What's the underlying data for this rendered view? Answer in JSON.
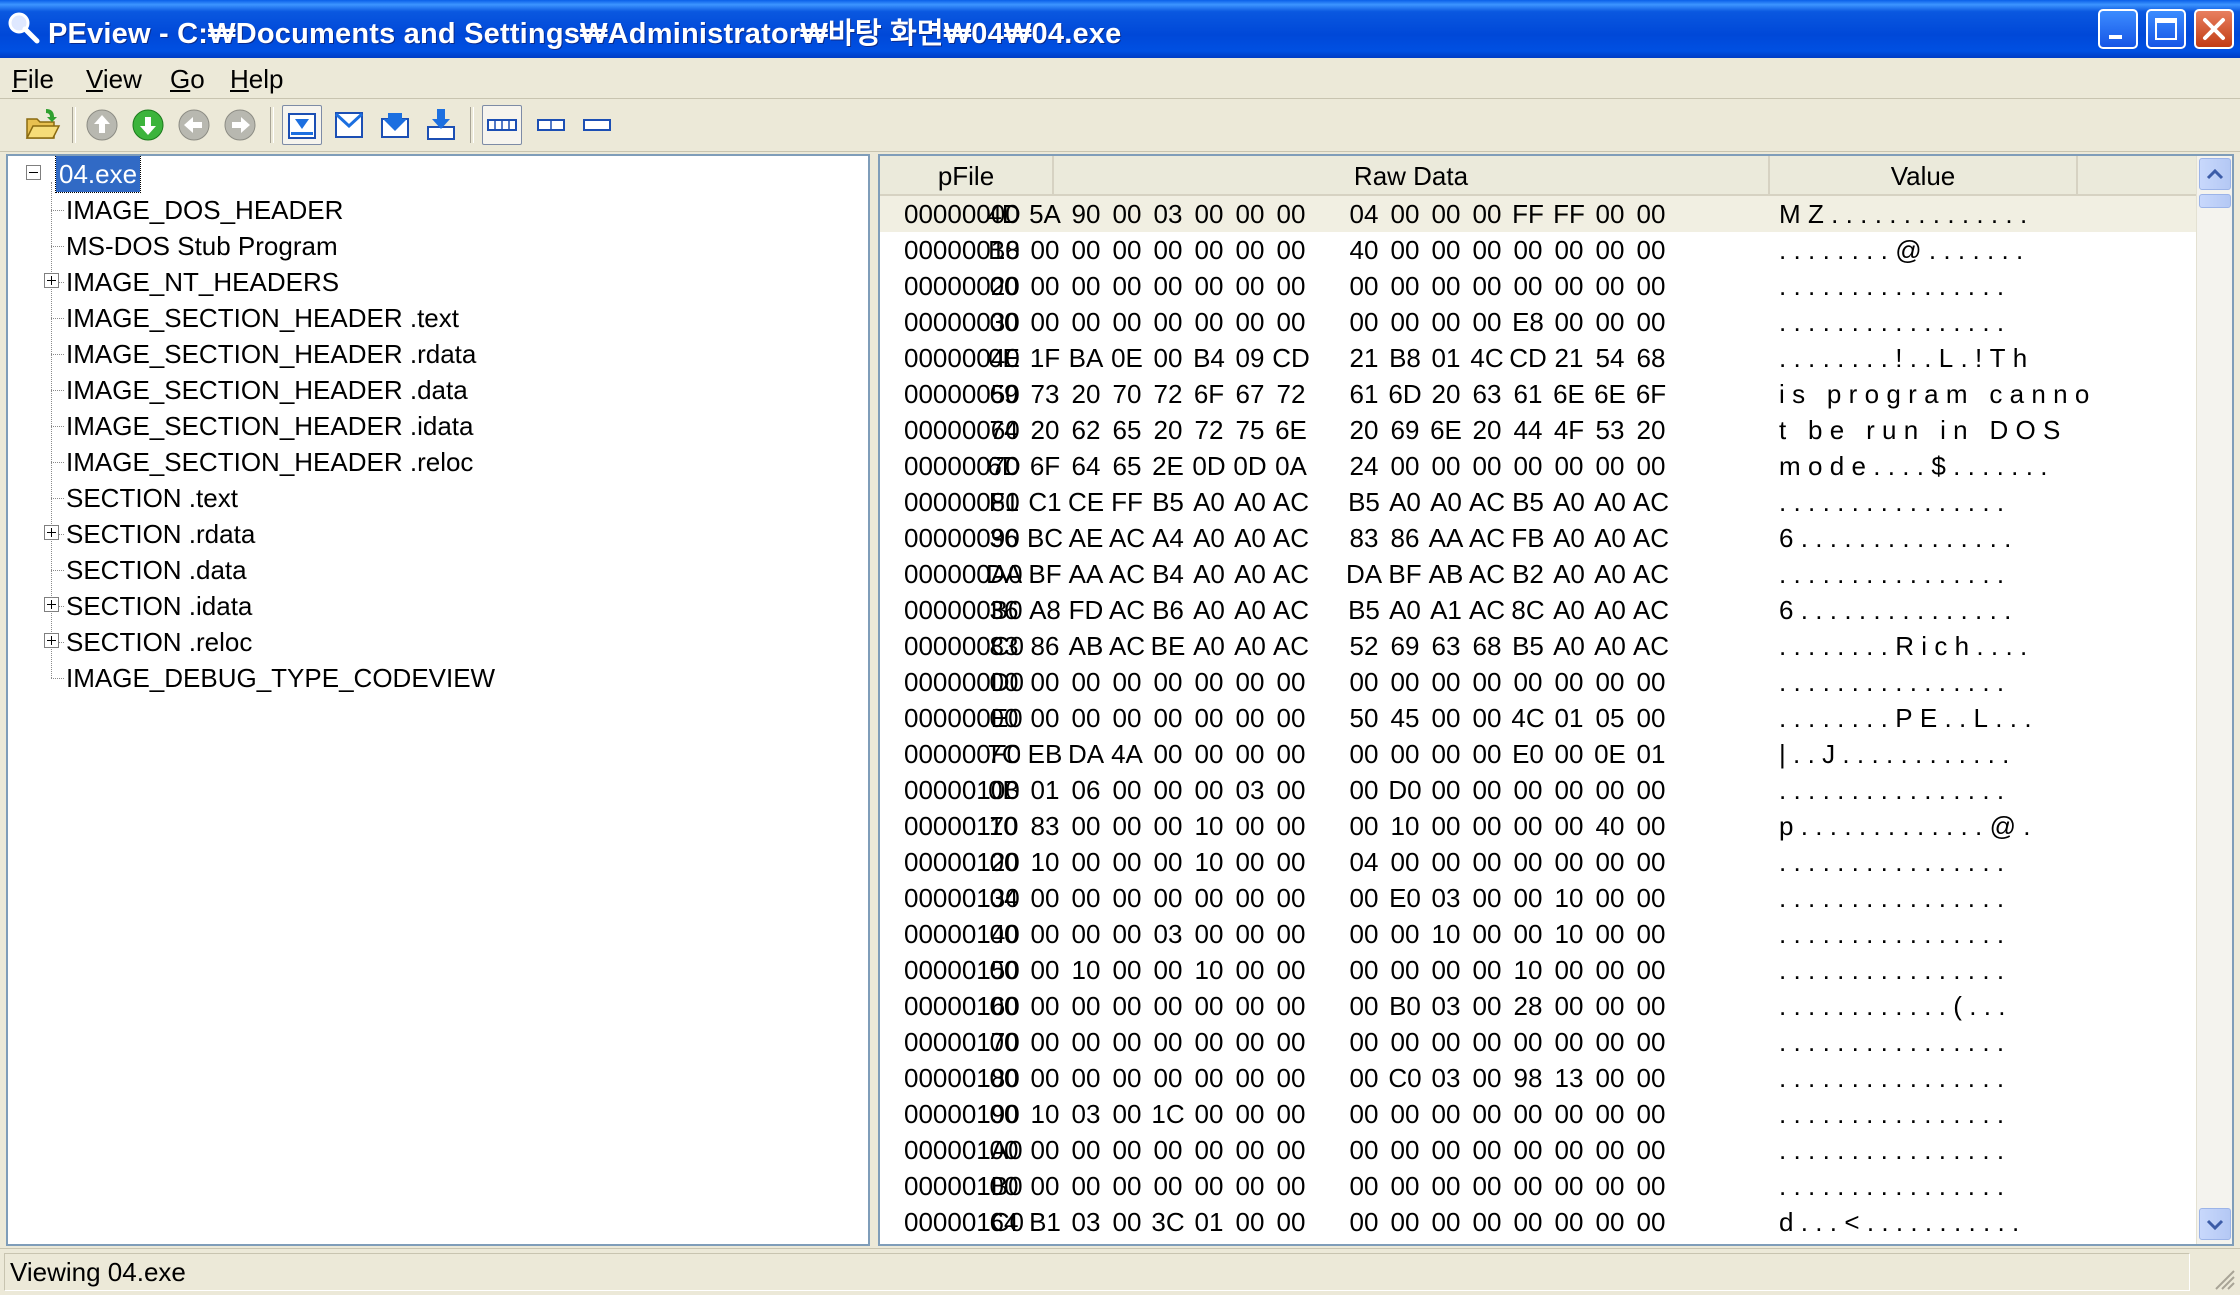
{
  "window": {
    "title": "PEview - C:₩Documents and Settings₩Administrator₩바탕 화면₩04₩04.exe",
    "minimize_icon": "minimize-icon",
    "maximize_icon": "maximize-icon",
    "close_icon": "close-icon"
  },
  "menu": [
    "File",
    "View",
    "Go",
    "Help"
  ],
  "toolbar": {
    "buttons": [
      "open-file-icon",
      "go-up-icon",
      "go-down-icon",
      "go-back-icon",
      "go-forward-icon",
      "view-byte-icon",
      "view-word-icon",
      "view-dword-icon",
      "view-qword-icon",
      "row-wide-icon",
      "row-medium-icon",
      "row-narrow-icon"
    ]
  },
  "tree": {
    "root": "04.exe",
    "items": [
      {
        "label": "IMAGE_DOS_HEADER",
        "expandable": false
      },
      {
        "label": "MS-DOS Stub Program",
        "expandable": false
      },
      {
        "label": "IMAGE_NT_HEADERS",
        "expandable": true
      },
      {
        "label": "IMAGE_SECTION_HEADER .text",
        "expandable": false
      },
      {
        "label": "IMAGE_SECTION_HEADER .rdata",
        "expandable": false
      },
      {
        "label": "IMAGE_SECTION_HEADER .data",
        "expandable": false
      },
      {
        "label": "IMAGE_SECTION_HEADER .idata",
        "expandable": false
      },
      {
        "label": "IMAGE_SECTION_HEADER .reloc",
        "expandable": false
      },
      {
        "label": "SECTION .text",
        "expandable": false
      },
      {
        "label": "SECTION .rdata",
        "expandable": true
      },
      {
        "label": "SECTION .data",
        "expandable": false
      },
      {
        "label": "SECTION .idata",
        "expandable": true
      },
      {
        "label": "SECTION .reloc",
        "expandable": true
      },
      {
        "label": "IMAGE_DEBUG_TYPE_CODEVIEW",
        "expandable": false
      }
    ]
  },
  "list": {
    "columns": {
      "pfile": "pFile",
      "raw": "Raw Data",
      "value": "Value"
    },
    "rows": [
      {
        "pfile": "00000000",
        "raw": [
          "4D",
          "5A",
          "90",
          "00",
          "03",
          "00",
          "00",
          "00",
          "04",
          "00",
          "00",
          "00",
          "FF",
          "FF",
          "00",
          "00"
        ],
        "value": "MZ.............."
      },
      {
        "pfile": "00000010",
        "raw": [
          "B8",
          "00",
          "00",
          "00",
          "00",
          "00",
          "00",
          "00",
          "40",
          "00",
          "00",
          "00",
          "00",
          "00",
          "00",
          "00"
        ],
        "value": "........@......."
      },
      {
        "pfile": "00000020",
        "raw": [
          "00",
          "00",
          "00",
          "00",
          "00",
          "00",
          "00",
          "00",
          "00",
          "00",
          "00",
          "00",
          "00",
          "00",
          "00",
          "00"
        ],
        "value": "................"
      },
      {
        "pfile": "00000030",
        "raw": [
          "00",
          "00",
          "00",
          "00",
          "00",
          "00",
          "00",
          "00",
          "00",
          "00",
          "00",
          "00",
          "E8",
          "00",
          "00",
          "00"
        ],
        "value": "................"
      },
      {
        "pfile": "00000040",
        "raw": [
          "0E",
          "1F",
          "BA",
          "0E",
          "00",
          "B4",
          "09",
          "CD",
          "21",
          "B8",
          "01",
          "4C",
          "CD",
          "21",
          "54",
          "68"
        ],
        "value": "........!..L.!Th"
      },
      {
        "pfile": "00000050",
        "raw": [
          "69",
          "73",
          "20",
          "70",
          "72",
          "6F",
          "67",
          "72",
          "61",
          "6D",
          "20",
          "63",
          "61",
          "6E",
          "6E",
          "6F"
        ],
        "value": "is program canno"
      },
      {
        "pfile": "00000060",
        "raw": [
          "74",
          "20",
          "62",
          "65",
          "20",
          "72",
          "75",
          "6E",
          "20",
          "69",
          "6E",
          "20",
          "44",
          "4F",
          "53",
          "20"
        ],
        "value": "t be run in DOS "
      },
      {
        "pfile": "00000070",
        "raw": [
          "6D",
          "6F",
          "64",
          "65",
          "2E",
          "0D",
          "0D",
          "0A",
          "24",
          "00",
          "00",
          "00",
          "00",
          "00",
          "00",
          "00"
        ],
        "value": "mode....$......."
      },
      {
        "pfile": "00000080",
        "raw": [
          "F1",
          "C1",
          "CE",
          "FF",
          "B5",
          "A0",
          "A0",
          "AC",
          "B5",
          "A0",
          "A0",
          "AC",
          "B5",
          "A0",
          "A0",
          "AC"
        ],
        "value": "................"
      },
      {
        "pfile": "00000090",
        "raw": [
          "36",
          "BC",
          "AE",
          "AC",
          "A4",
          "A0",
          "A0",
          "AC",
          "83",
          "86",
          "AA",
          "AC",
          "FB",
          "A0",
          "A0",
          "AC"
        ],
        "value": "6..............."
      },
      {
        "pfile": "000000A0",
        "raw": [
          "DA",
          "BF",
          "AA",
          "AC",
          "B4",
          "A0",
          "A0",
          "AC",
          "DA",
          "BF",
          "AB",
          "AC",
          "B2",
          "A0",
          "A0",
          "AC"
        ],
        "value": "................"
      },
      {
        "pfile": "000000B0",
        "raw": [
          "36",
          "A8",
          "FD",
          "AC",
          "B6",
          "A0",
          "A0",
          "AC",
          "B5",
          "A0",
          "A1",
          "AC",
          "8C",
          "A0",
          "A0",
          "AC"
        ],
        "value": "6..............."
      },
      {
        "pfile": "000000C0",
        "raw": [
          "83",
          "86",
          "AB",
          "AC",
          "BE",
          "A0",
          "A0",
          "AC",
          "52",
          "69",
          "63",
          "68",
          "B5",
          "A0",
          "A0",
          "AC"
        ],
        "value": "........Rich...."
      },
      {
        "pfile": "000000D0",
        "raw": [
          "00",
          "00",
          "00",
          "00",
          "00",
          "00",
          "00",
          "00",
          "00",
          "00",
          "00",
          "00",
          "00",
          "00",
          "00",
          "00"
        ],
        "value": "................"
      },
      {
        "pfile": "000000E0",
        "raw": [
          "00",
          "00",
          "00",
          "00",
          "00",
          "00",
          "00",
          "00",
          "50",
          "45",
          "00",
          "00",
          "4C",
          "01",
          "05",
          "00"
        ],
        "value": "........PE..L..."
      },
      {
        "pfile": "000000F0",
        "raw": [
          "7C",
          "EB",
          "DA",
          "4A",
          "00",
          "00",
          "00",
          "00",
          "00",
          "00",
          "00",
          "00",
          "E0",
          "00",
          "0E",
          "01"
        ],
        "value": "|..J............"
      },
      {
        "pfile": "00000100",
        "raw": [
          "0B",
          "01",
          "06",
          "00",
          "00",
          "00",
          "03",
          "00",
          "00",
          "D0",
          "00",
          "00",
          "00",
          "00",
          "00",
          "00"
        ],
        "value": "................"
      },
      {
        "pfile": "00000110",
        "raw": [
          "70",
          "83",
          "00",
          "00",
          "00",
          "10",
          "00",
          "00",
          "00",
          "10",
          "00",
          "00",
          "00",
          "00",
          "40",
          "00"
        ],
        "value": "p.............@."
      },
      {
        "pfile": "00000120",
        "raw": [
          "00",
          "10",
          "00",
          "00",
          "00",
          "10",
          "00",
          "00",
          "04",
          "00",
          "00",
          "00",
          "00",
          "00",
          "00",
          "00"
        ],
        "value": "................"
      },
      {
        "pfile": "00000130",
        "raw": [
          "04",
          "00",
          "00",
          "00",
          "00",
          "00",
          "00",
          "00",
          "00",
          "E0",
          "03",
          "00",
          "00",
          "10",
          "00",
          "00"
        ],
        "value": "................"
      },
      {
        "pfile": "00000140",
        "raw": [
          "00",
          "00",
          "00",
          "00",
          "03",
          "00",
          "00",
          "00",
          "00",
          "00",
          "10",
          "00",
          "00",
          "10",
          "00",
          "00"
        ],
        "value": "................"
      },
      {
        "pfile": "00000150",
        "raw": [
          "00",
          "00",
          "10",
          "00",
          "00",
          "10",
          "00",
          "00",
          "00",
          "00",
          "00",
          "00",
          "10",
          "00",
          "00",
          "00"
        ],
        "value": "................"
      },
      {
        "pfile": "00000160",
        "raw": [
          "00",
          "00",
          "00",
          "00",
          "00",
          "00",
          "00",
          "00",
          "00",
          "B0",
          "03",
          "00",
          "28",
          "00",
          "00",
          "00"
        ],
        "value": "............(..."
      },
      {
        "pfile": "00000170",
        "raw": [
          "00",
          "00",
          "00",
          "00",
          "00",
          "00",
          "00",
          "00",
          "00",
          "00",
          "00",
          "00",
          "00",
          "00",
          "00",
          "00"
        ],
        "value": "................"
      },
      {
        "pfile": "00000180",
        "raw": [
          "00",
          "00",
          "00",
          "00",
          "00",
          "00",
          "00",
          "00",
          "00",
          "C0",
          "03",
          "00",
          "98",
          "13",
          "00",
          "00"
        ],
        "value": "................"
      },
      {
        "pfile": "00000190",
        "raw": [
          "00",
          "10",
          "03",
          "00",
          "1C",
          "00",
          "00",
          "00",
          "00",
          "00",
          "00",
          "00",
          "00",
          "00",
          "00",
          "00"
        ],
        "value": "................"
      },
      {
        "pfile": "000001A0",
        "raw": [
          "00",
          "00",
          "00",
          "00",
          "00",
          "00",
          "00",
          "00",
          "00",
          "00",
          "00",
          "00",
          "00",
          "00",
          "00",
          "00"
        ],
        "value": "................"
      },
      {
        "pfile": "000001B0",
        "raw": [
          "00",
          "00",
          "00",
          "00",
          "00",
          "00",
          "00",
          "00",
          "00",
          "00",
          "00",
          "00",
          "00",
          "00",
          "00",
          "00"
        ],
        "value": "................"
      },
      {
        "pfile": "000001C0",
        "raw": [
          "64",
          "B1",
          "03",
          "00",
          "3C",
          "01",
          "00",
          "00",
          "00",
          "00",
          "00",
          "00",
          "00",
          "00",
          "00",
          "00"
        ],
        "value": "d...<..........."
      }
    ]
  },
  "status": {
    "text": "Viewing 04.exe"
  }
}
